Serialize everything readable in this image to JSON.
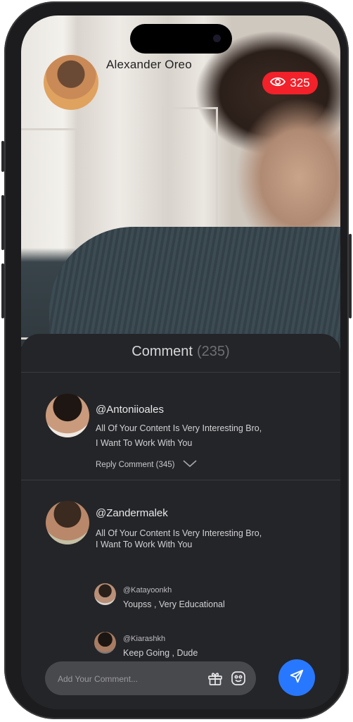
{
  "stream": {
    "host_name": "Alexander Oreo",
    "viewer_count": "325",
    "icons": {
      "viewers": "eye-icon"
    }
  },
  "comments_sheet": {
    "title": "Comment",
    "count": "(235)"
  },
  "comments": [
    {
      "username": "@Antoniioales",
      "text_line1": "All Of Your Content Is Very Interesting Bro,",
      "text_line2": "I Want To Work With You",
      "reply_label": "Reply Comment",
      "reply_count": "(345)"
    },
    {
      "username": "@Zandermalek",
      "text_line1": "All Of Your Content Is Very Interesting Bro,",
      "text_line2": "I Want To Work With You",
      "replies": [
        {
          "username": "@Katayoonkh",
          "text": "Youpss , Very Educational"
        },
        {
          "username": "@Kiarashkh",
          "text": "Keep Going ,  Dude"
        }
      ]
    }
  ],
  "composer": {
    "placeholder": "Add Your Comment...",
    "icons": [
      "gift-icon",
      "emoji-icon",
      "send-icon"
    ]
  },
  "colors": {
    "accent_blue": "#2878ff",
    "live_red": "#f2212a",
    "sheet_bg": "#242528"
  }
}
